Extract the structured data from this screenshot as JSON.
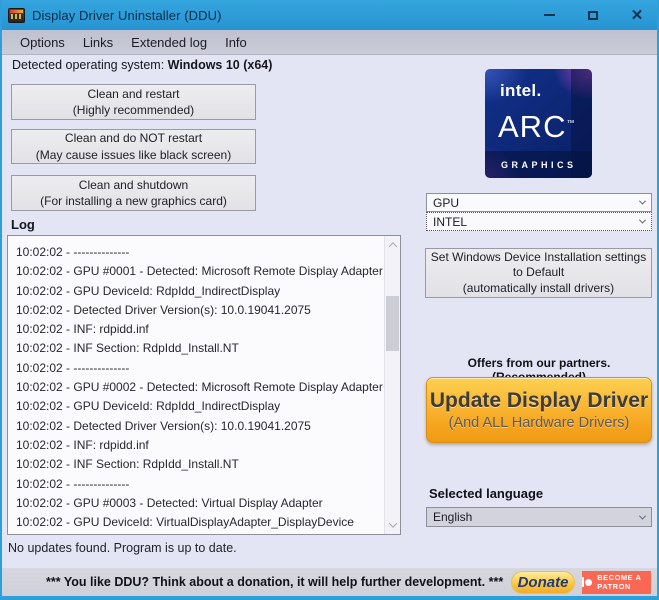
{
  "window": {
    "title": "Display Driver Uninstaller (DDU)",
    "close_glyph": "✕"
  },
  "menu": {
    "items": [
      "Options",
      "Links",
      "Extended log",
      "Info"
    ]
  },
  "os": {
    "label": "Detected operating system: ",
    "value": "Windows 10 (x64)"
  },
  "actions": [
    {
      "line1": "Clean and restart",
      "line2": "(Highly recommended)"
    },
    {
      "line1": "Clean and do NOT restart",
      "line2": "(May cause issues like black screen)"
    },
    {
      "line1": "Clean and shutdown",
      "line2": "(For installing a new graphics card)"
    }
  ],
  "log": {
    "label": "Log",
    "entries": [
      "10:02:02 - --------------",
      "10:02:02 - GPU #0001 - Detected: Microsoft Remote Display Adapter",
      "10:02:02 - GPU DeviceId: RdpIdd_IndirectDisplay",
      "10:02:02 - Detected Driver Version(s): 10.0.19041.2075",
      "10:02:02 - INF: rdpidd.inf",
      "10:02:02 - INF Section: RdpIdd_Install.NT",
      "10:02:02 - --------------",
      "10:02:02 - GPU #0002 - Detected: Microsoft Remote Display Adapter",
      "10:02:02 - GPU DeviceId: RdpIdd_IndirectDisplay",
      "10:02:02 - Detected Driver Version(s): 10.0.19041.2075",
      "10:02:02 - INF: rdpidd.inf",
      "10:02:02 - INF Section: RdpIdd_Install.NT",
      "10:02:02 - --------------",
      "10:02:02 - GPU #0003 - Detected: Virtual Display Adapter",
      "10:02:02 - GPU DeviceId: VirtualDisplayAdapter_DisplayDevice"
    ],
    "status": "No updates found. Program is up to date."
  },
  "arc_logo": {
    "brand": "intel.",
    "product": "ARC",
    "tm": "™",
    "sub": "GRAPHICS"
  },
  "selectors": {
    "device_type_value": "GPU",
    "vendor_value": "INTEL",
    "language_label": "Selected language",
    "language_value": "English"
  },
  "device_settings_button": {
    "line1": "Set Windows Device Installation settings",
    "line2": "to Default",
    "line3": "(automatically install drivers)"
  },
  "partners": {
    "label": "Offers from our partners. (Recommended)",
    "button_line1": "Update Display Driver",
    "button_line2": "(And ALL Hardware Drivers)"
  },
  "donation": {
    "message": "*** You like DDU? Think about a donation, it will help further development. ***",
    "donate_label": "Donate",
    "patron_label": "BECOME A PATRON"
  },
  "colors": {
    "titlebar_blue": "#2e9fd9",
    "window_background": "#e3e5f4",
    "update_button_orange": "#f6a41e",
    "donate_gold": "#fbc53d",
    "patron_red": "#f96854",
    "arc_navy": "#0a1f63"
  }
}
